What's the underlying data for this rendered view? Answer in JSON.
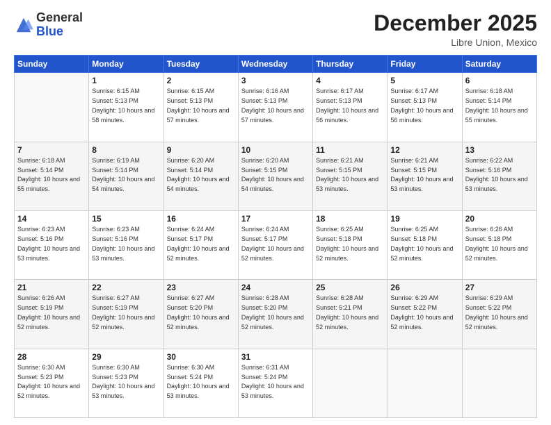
{
  "header": {
    "logo_general": "General",
    "logo_blue": "Blue",
    "month": "December 2025",
    "location": "Libre Union, Mexico"
  },
  "columns": [
    "Sunday",
    "Monday",
    "Tuesday",
    "Wednesday",
    "Thursday",
    "Friday",
    "Saturday"
  ],
  "weeks": [
    [
      {
        "day": "",
        "empty": true
      },
      {
        "day": "1",
        "sunrise": "6:15 AM",
        "sunset": "5:13 PM",
        "daylight": "10 hours and 58 minutes."
      },
      {
        "day": "2",
        "sunrise": "6:15 AM",
        "sunset": "5:13 PM",
        "daylight": "10 hours and 57 minutes."
      },
      {
        "day": "3",
        "sunrise": "6:16 AM",
        "sunset": "5:13 PM",
        "daylight": "10 hours and 57 minutes."
      },
      {
        "day": "4",
        "sunrise": "6:17 AM",
        "sunset": "5:13 PM",
        "daylight": "10 hours and 56 minutes."
      },
      {
        "day": "5",
        "sunrise": "6:17 AM",
        "sunset": "5:13 PM",
        "daylight": "10 hours and 56 minutes."
      },
      {
        "day": "6",
        "sunrise": "6:18 AM",
        "sunset": "5:14 PM",
        "daylight": "10 hours and 55 minutes."
      }
    ],
    [
      {
        "day": "7",
        "sunrise": "6:18 AM",
        "sunset": "5:14 PM",
        "daylight": "10 hours and 55 minutes."
      },
      {
        "day": "8",
        "sunrise": "6:19 AM",
        "sunset": "5:14 PM",
        "daylight": "10 hours and 54 minutes."
      },
      {
        "day": "9",
        "sunrise": "6:20 AM",
        "sunset": "5:14 PM",
        "daylight": "10 hours and 54 minutes."
      },
      {
        "day": "10",
        "sunrise": "6:20 AM",
        "sunset": "5:15 PM",
        "daylight": "10 hours and 54 minutes."
      },
      {
        "day": "11",
        "sunrise": "6:21 AM",
        "sunset": "5:15 PM",
        "daylight": "10 hours and 53 minutes."
      },
      {
        "day": "12",
        "sunrise": "6:21 AM",
        "sunset": "5:15 PM",
        "daylight": "10 hours and 53 minutes."
      },
      {
        "day": "13",
        "sunrise": "6:22 AM",
        "sunset": "5:16 PM",
        "daylight": "10 hours and 53 minutes."
      }
    ],
    [
      {
        "day": "14",
        "sunrise": "6:23 AM",
        "sunset": "5:16 PM",
        "daylight": "10 hours and 53 minutes."
      },
      {
        "day": "15",
        "sunrise": "6:23 AM",
        "sunset": "5:16 PM",
        "daylight": "10 hours and 53 minutes."
      },
      {
        "day": "16",
        "sunrise": "6:24 AM",
        "sunset": "5:17 PM",
        "daylight": "10 hours and 52 minutes."
      },
      {
        "day": "17",
        "sunrise": "6:24 AM",
        "sunset": "5:17 PM",
        "daylight": "10 hours and 52 minutes."
      },
      {
        "day": "18",
        "sunrise": "6:25 AM",
        "sunset": "5:18 PM",
        "daylight": "10 hours and 52 minutes."
      },
      {
        "day": "19",
        "sunrise": "6:25 AM",
        "sunset": "5:18 PM",
        "daylight": "10 hours and 52 minutes."
      },
      {
        "day": "20",
        "sunrise": "6:26 AM",
        "sunset": "5:18 PM",
        "daylight": "10 hours and 52 minutes."
      }
    ],
    [
      {
        "day": "21",
        "sunrise": "6:26 AM",
        "sunset": "5:19 PM",
        "daylight": "10 hours and 52 minutes."
      },
      {
        "day": "22",
        "sunrise": "6:27 AM",
        "sunset": "5:19 PM",
        "daylight": "10 hours and 52 minutes."
      },
      {
        "day": "23",
        "sunrise": "6:27 AM",
        "sunset": "5:20 PM",
        "daylight": "10 hours and 52 minutes."
      },
      {
        "day": "24",
        "sunrise": "6:28 AM",
        "sunset": "5:20 PM",
        "daylight": "10 hours and 52 minutes."
      },
      {
        "day": "25",
        "sunrise": "6:28 AM",
        "sunset": "5:21 PM",
        "daylight": "10 hours and 52 minutes."
      },
      {
        "day": "26",
        "sunrise": "6:29 AM",
        "sunset": "5:22 PM",
        "daylight": "10 hours and 52 minutes."
      },
      {
        "day": "27",
        "sunrise": "6:29 AM",
        "sunset": "5:22 PM",
        "daylight": "10 hours and 52 minutes."
      }
    ],
    [
      {
        "day": "28",
        "sunrise": "6:30 AM",
        "sunset": "5:23 PM",
        "daylight": "10 hours and 52 minutes."
      },
      {
        "day": "29",
        "sunrise": "6:30 AM",
        "sunset": "5:23 PM",
        "daylight": "10 hours and 53 minutes."
      },
      {
        "day": "30",
        "sunrise": "6:30 AM",
        "sunset": "5:24 PM",
        "daylight": "10 hours and 53 minutes."
      },
      {
        "day": "31",
        "sunrise": "6:31 AM",
        "sunset": "5:24 PM",
        "daylight": "10 hours and 53 minutes."
      },
      {
        "day": "",
        "empty": true
      },
      {
        "day": "",
        "empty": true
      },
      {
        "day": "",
        "empty": true
      }
    ]
  ]
}
